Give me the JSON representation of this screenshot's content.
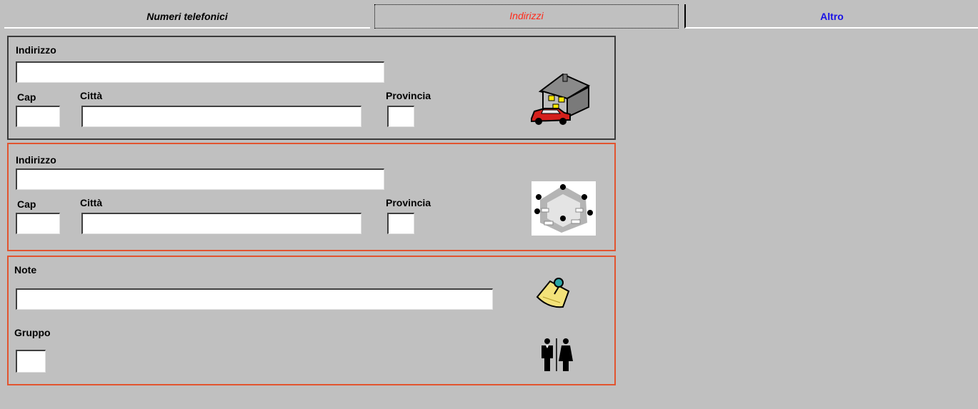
{
  "tabs": [
    {
      "label": "Numeri telefonici",
      "active": false
    },
    {
      "label": "Indirizzi",
      "active": true
    },
    {
      "label": "Altro",
      "active": false
    }
  ],
  "address_primary": {
    "indirizzo_label": "Indirizzo",
    "indirizzo_value": "",
    "cap_label": "Cap",
    "cap_value": "",
    "citta_label": "Città",
    "citta_value": "",
    "provincia_label": "Provincia",
    "provincia_value": "",
    "icon": "house-car-icon"
  },
  "address_secondary": {
    "indirizzo_label": "Indirizzo",
    "indirizzo_value": "",
    "cap_label": "Cap",
    "cap_value": "",
    "citta_label": "Città",
    "citta_value": "",
    "provincia_label": "Provincia",
    "provincia_value": "",
    "icon": "network-icon"
  },
  "other": {
    "note_label": "Note",
    "note_value": "",
    "gruppo_label": "Gruppo",
    "gruppo_value": "",
    "note_icon": "sticky-note-pin-icon",
    "gruppo_icon": "people-icon"
  },
  "colors": {
    "background": "#c0c0c0",
    "active_tab_text": "#ff2a1a",
    "altro_tab_text": "#1a12e6",
    "panel_border_active": "#e2542f",
    "panel_border": "#3a3a3a"
  }
}
